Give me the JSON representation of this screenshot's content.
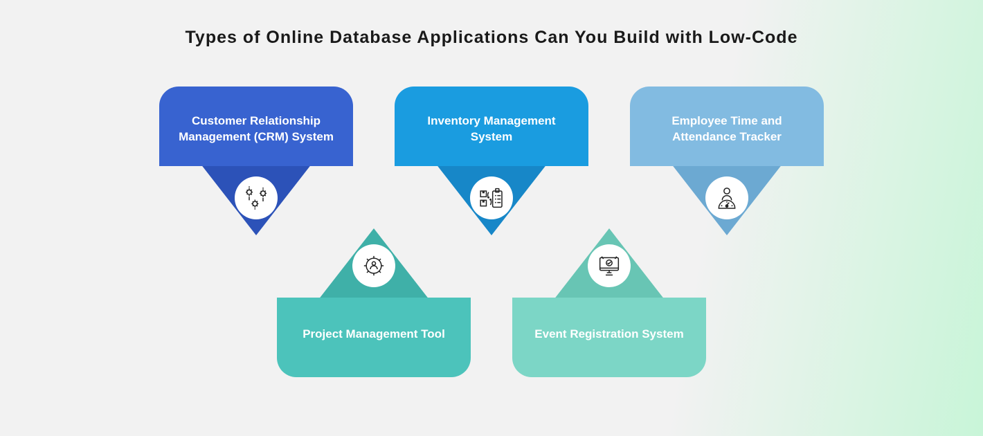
{
  "title": "Types of Online Database Applications Can You Build with Low-Code",
  "cards": {
    "top": [
      {
        "label": "Customer Relationship Management (CRM) System",
        "icon": "gears"
      },
      {
        "label": "Inventory Management System",
        "icon": "inventory"
      },
      {
        "label": "Employee Time and Attendance Tracker",
        "icon": "time"
      }
    ],
    "bottom": [
      {
        "label": "Project Management Tool",
        "icon": "project"
      },
      {
        "label": "Event Registration System",
        "icon": "register"
      }
    ]
  }
}
